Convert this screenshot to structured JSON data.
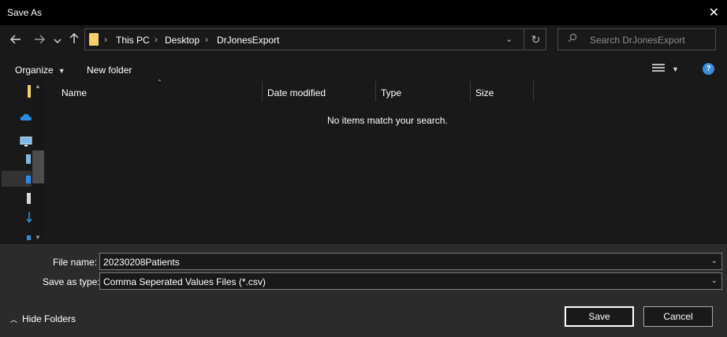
{
  "window": {
    "title": "Save As",
    "close_glyph": "✕"
  },
  "nav": {
    "back_icon": "arrow-left-icon",
    "forward_icon": "arrow-right-icon",
    "recent_icon": "chevron-down-icon",
    "up_icon": "arrow-up-icon"
  },
  "address": {
    "crumbs": [
      "This PC",
      "Desktop",
      "DrJonesExport"
    ]
  },
  "search": {
    "placeholder": "Search DrJonesExport"
  },
  "toolbar": {
    "organize": "Organize",
    "new_folder": "New folder"
  },
  "columns": [
    "Name",
    "Date modified",
    "Type",
    "Size"
  ],
  "filelist": {
    "empty_message": "No items match your search."
  },
  "form": {
    "file_name_label": "File name:",
    "file_name_value": "20230208Patients",
    "save_type_label": "Save as type:",
    "save_type_value": "Comma Seperated Values Files (*.csv)"
  },
  "footer": {
    "hide_folders": "Hide Folders",
    "save": "Save",
    "cancel": "Cancel"
  },
  "colors": {
    "accent": "#3a8cdc",
    "folder": "#f4d066",
    "background": "#191919",
    "footer": "#2b2b2b"
  }
}
